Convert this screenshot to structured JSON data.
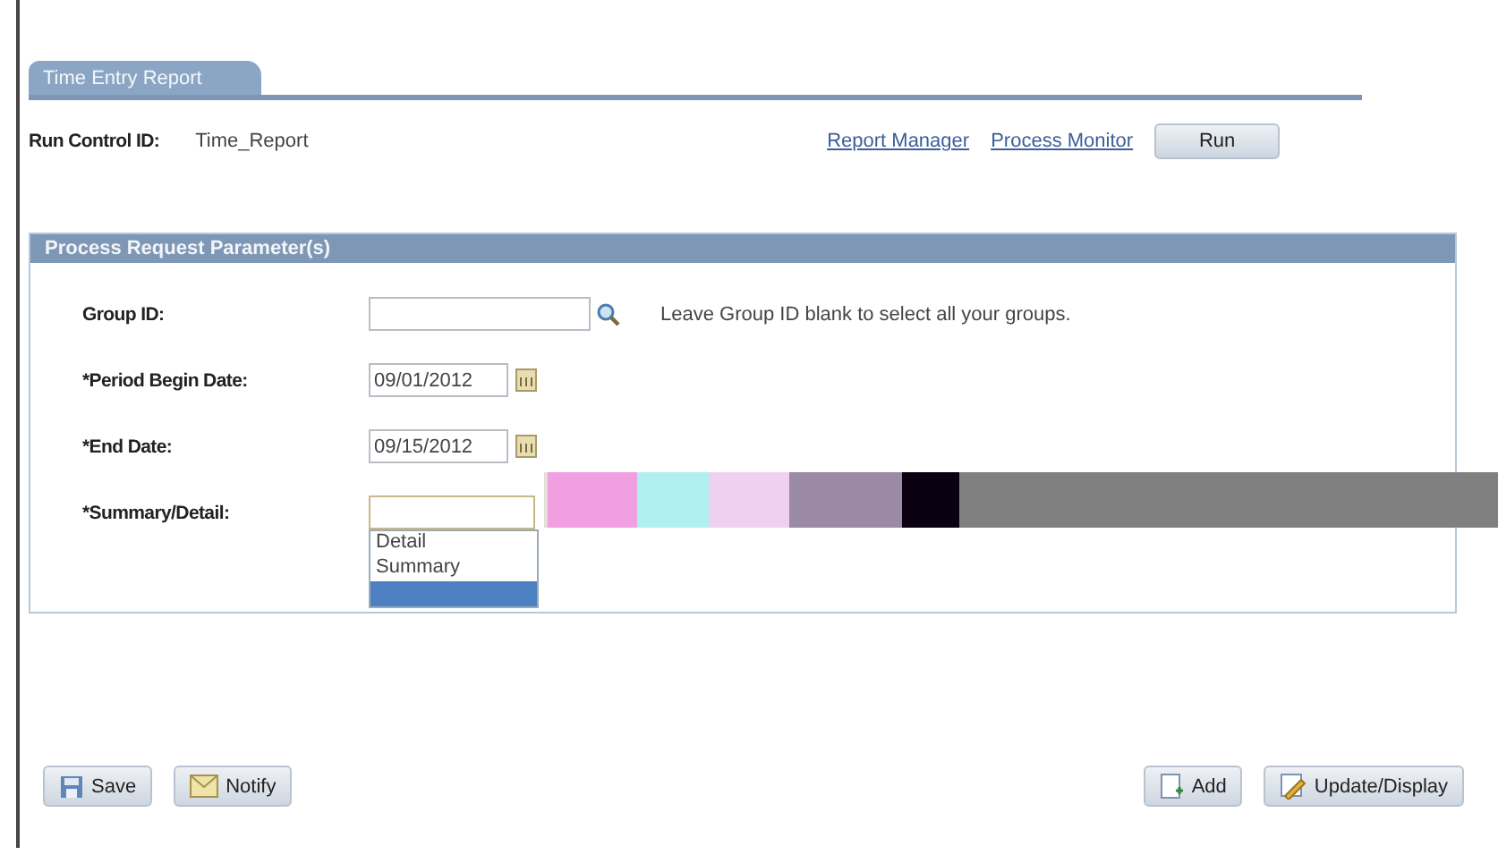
{
  "tab": {
    "label": "Time Entry Report",
    "selected": true
  },
  "run_control": {
    "label": "Run Control ID:",
    "value": "Time_Report"
  },
  "links": [
    "Report Manager",
    "Process Monitor"
  ],
  "run_button": "Run",
  "panel": {
    "title": "Process Request Parameter(s)",
    "fields": [
      {
        "kind": "lookup",
        "label": "Group ID:",
        "hint": "Leave Group ID blank to select all your groups."
      },
      {
        "kind": "date",
        "label": "*Period Begin Date:",
        "value": "09/01/2012"
      },
      {
        "kind": "date",
        "label": "*End Date:",
        "value": "09/15/2012"
      },
      {
        "kind": "select",
        "label": "*Summary/Detail:",
        "expanded": true,
        "options": [
          {
            "label": "Detail",
            "selected": false
          },
          {
            "label": "Summary",
            "selected": false
          },
          {
            "selected": true
          }
        ]
      }
    ]
  },
  "footer_left": [
    {
      "kind": "save",
      "label": "Save"
    },
    {
      "kind": "notify",
      "label": "Notify"
    }
  ],
  "footer_right": [
    {
      "kind": "add",
      "label": "Add"
    },
    {
      "kind": "update",
      "label": "Update/Display"
    }
  ]
}
